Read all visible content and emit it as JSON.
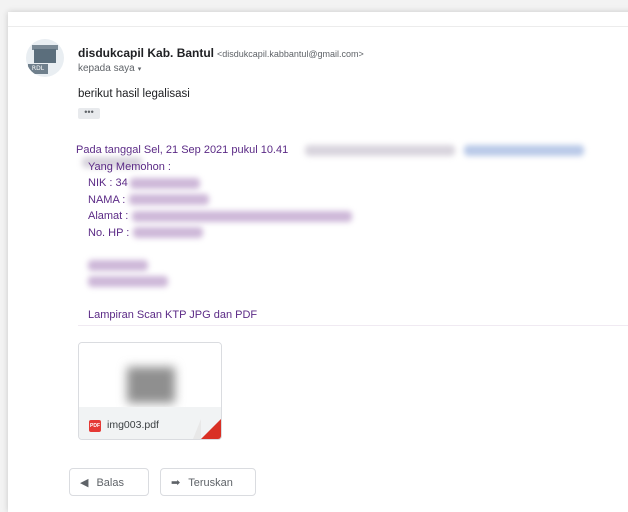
{
  "email": {
    "sender_name": "disdukcapil Kab. Bantul",
    "sender_email": "<disdukcapil.kabbantul@gmail.com>",
    "to_label": "kepada saya",
    "to_caret": "▾",
    "subject": "berikut  hasil legalisasi",
    "more": "•••",
    "avatar_label": "RDL"
  },
  "quote": {
    "intro": "Pada tanggal Sel, 21 Sep 2021 pukul 10.41",
    "lines": {
      "requester": "Yang Memohon :",
      "nik": "NIK : 34",
      "nama": "NAMA :",
      "alamat": "Alamat :",
      "hp": "No. HP :",
      "attachment_note": "Lampiran Scan KTP JPG dan PDF"
    }
  },
  "attachment": {
    "filename": "img003.pdf",
    "type_icon": "pdf-icon",
    "type_label": "PDF"
  },
  "actions": {
    "reply_label": "Balas",
    "reply_icon": "◀",
    "forward_label": "Teruskan",
    "forward_icon": "➡"
  },
  "colors": {
    "quote_text": "#5b2a86",
    "pdf_red": "#e53935"
  }
}
